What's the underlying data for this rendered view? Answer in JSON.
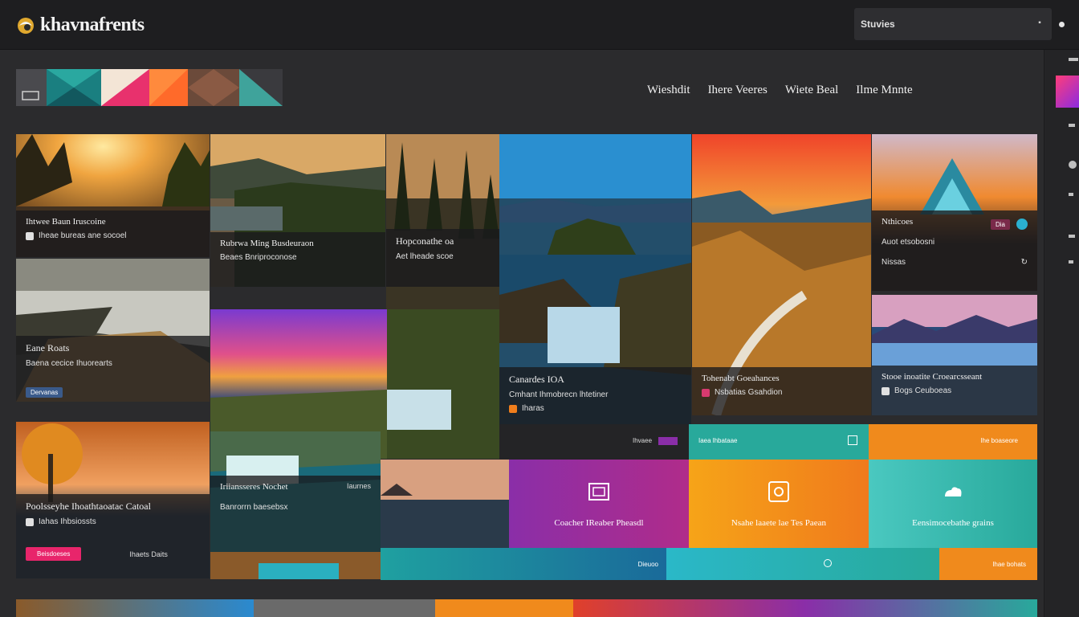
{
  "header": {
    "logo_text": "khavnafrents",
    "search_label": "Stuvies",
    "search_button_glyph": "▪"
  },
  "nav": [
    {
      "label": "Wieshdit"
    },
    {
      "label": "Ihere Veeres"
    },
    {
      "label": "Wiete Beal"
    },
    {
      "label": "Ilme Mnnte"
    }
  ],
  "swatch_colors": [
    "#4a4a4e",
    "#1c8f8c",
    "#f2e3d4",
    "#ff6a2a",
    "#6b4a3a",
    "#3fa39b"
  ],
  "tiles": {
    "t1": {
      "title": "Ihtwee Baun Iruscoine",
      "sub": "Iheae bureas ane socoel"
    },
    "t2": {
      "title": "Rubrwa Ming Busdeuraon",
      "sub": "Beaes Bnriproconose"
    },
    "t3": {
      "title": "Hopconathe oa",
      "sub": "Aet lheade scoe"
    },
    "t4": {
      "title": "Eane Roats",
      "sub": "Baena cecice Ihuorearts",
      "badge": "Dervanas"
    },
    "t5": {
      "title": "Canardes IOA",
      "sub": "Cmhant Ihmobrecn lhtetiner",
      "meta": "Iharas"
    },
    "t6": {
      "title": "Tohenabt Goeahances",
      "sub": "Nsbatias Gsahdion"
    },
    "t7": {
      "title": "Nthicoes",
      "sub": "Auot etsobosni",
      "meta": "Nissas",
      "badge": "Dia"
    },
    "t8": {
      "title": "Stooe inoatite Croearcsseant",
      "sub": "Bogs Ceuboeas"
    },
    "t9": {
      "title": "Poolsseyhe Ihoathtaoatac Catoal",
      "sub": "Iahas Ihbsiossts",
      "button": "Beisdoeses",
      "meta": "Ihaets Daits"
    },
    "t10": {
      "title": "Iriiansseres Nochet",
      "sub": "Banrorrn baesebsx",
      "meta": "Iaurnes"
    }
  },
  "color_tiles": {
    "purple": {
      "label": "Coacher IReaber Pheasdl"
    },
    "orange": {
      "label": "Nsahe laaete lae Tes Paean"
    },
    "teal": {
      "label": "Eensimocebathe grains"
    },
    "bar1": {
      "label": "Ihvaee"
    },
    "teal_top": {
      "label": "Iaea lhbataae"
    },
    "orange_top": {
      "label": "Ihe boaseore"
    },
    "bot1": {
      "label": "Dieuoo"
    },
    "bot3": {
      "label": "Ihae bohats"
    }
  },
  "colors": {
    "purple": "#8a2ea8",
    "orange": "#f07e1c",
    "teal": "#28a99b",
    "pink": "#e8256b"
  }
}
